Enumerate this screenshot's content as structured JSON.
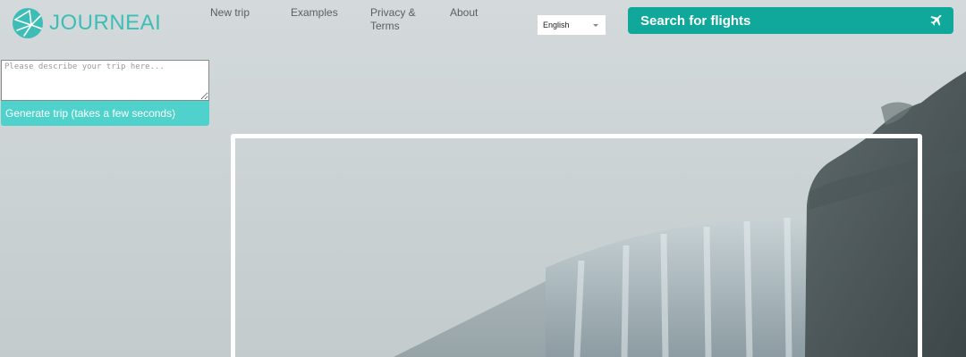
{
  "brand": {
    "name": "JOURNEAI",
    "accent": "#3dbdb6"
  },
  "nav": {
    "new_trip": "New trip",
    "examples": "Examples",
    "privacy_line1": "Privacy &",
    "privacy_line2": "Terms",
    "about": "About"
  },
  "language": {
    "selected": "English"
  },
  "flights": {
    "label": "Search for flights",
    "color": "#10a89a",
    "icon": "airplane-icon"
  },
  "trip_form": {
    "placeholder": "Please describe your trip here...",
    "value": "",
    "generate_label": "Generate trip (takes a few seconds)",
    "button_color": "#4fd2cc"
  },
  "hero": {
    "icon": "waterfall-photo"
  }
}
